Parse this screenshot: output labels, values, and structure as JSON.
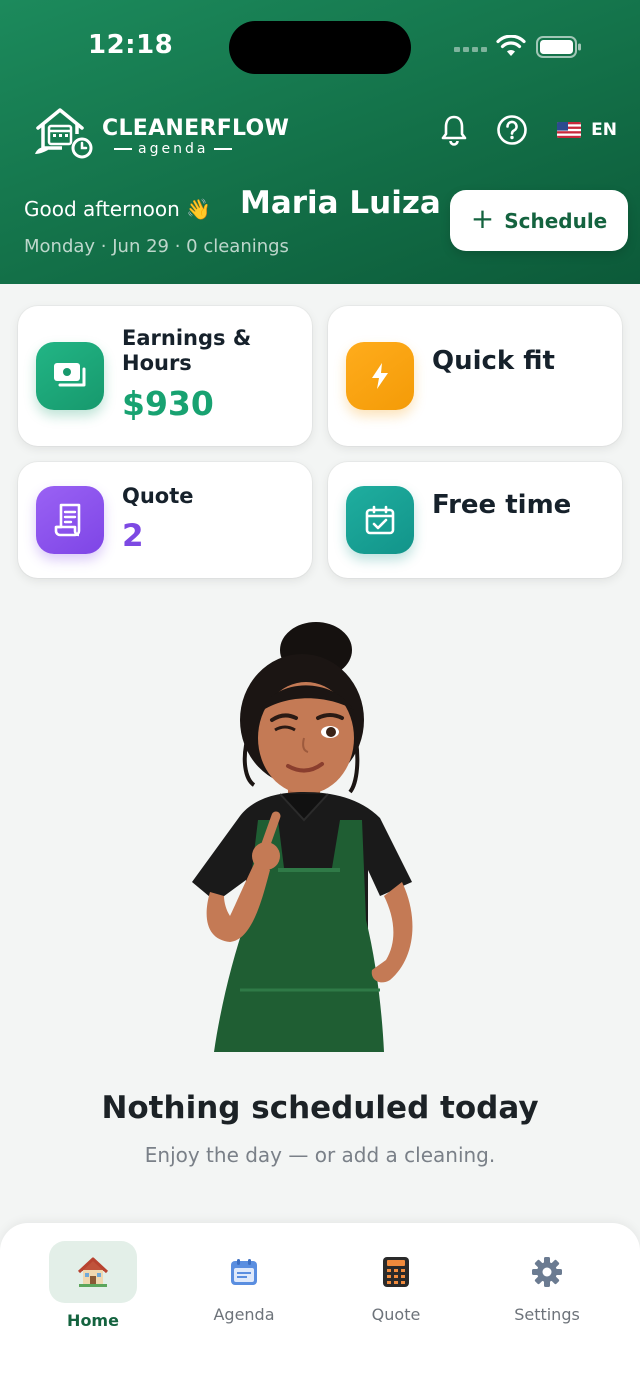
{
  "status_bar": {
    "time": "12:18"
  },
  "brand": {
    "name": "CLEANERFLOW",
    "tagline": "agenda"
  },
  "header": {
    "language": "EN",
    "greeting": "Good afternoon 👋",
    "user_name": "Maria Luiza",
    "subline": "Monday · Jun 29 · 0 cleanings",
    "schedule_button": "Schedule"
  },
  "cards": {
    "earnings": {
      "label": "Earnings & Hours",
      "value": "$930",
      "icon": "money-icon",
      "color": "#1aa877"
    },
    "quick_fit": {
      "label": "Quick fit",
      "icon": "lightning-icon",
      "color": "#f5a00c"
    },
    "quote": {
      "label": "Quote",
      "value": "2",
      "icon": "receipt-icon",
      "color": "#8550ea"
    },
    "free_time": {
      "label": "Free time",
      "icon": "calendar-check-icon",
      "color": "#17a194"
    }
  },
  "empty_state": {
    "title": "Nothing scheduled today",
    "subtitle": "Enjoy the day — or add a cleaning."
  },
  "tabs": [
    {
      "label": "Home",
      "icon": "house-icon",
      "active": true
    },
    {
      "label": "Agenda",
      "icon": "calendar-icon",
      "active": false
    },
    {
      "label": "Quote",
      "icon": "calculator-icon",
      "active": false
    },
    {
      "label": "Settings",
      "icon": "gear-icon",
      "active": false
    }
  ],
  "colors": {
    "brand_green": "#137048",
    "accent_green": "#14633f"
  }
}
